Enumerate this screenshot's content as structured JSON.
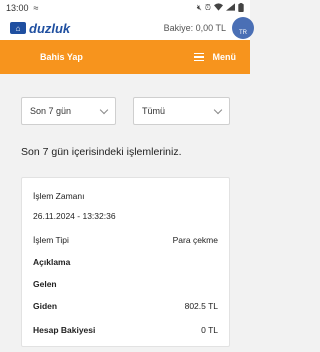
{
  "status_bar": {
    "time": "13:00",
    "left_icon": "vibrate-icon",
    "right_icons": [
      "mute-icon",
      "alarm-icon",
      "wifi-icon",
      "signal-icon",
      "battery-icon"
    ]
  },
  "header": {
    "logo_text": "duzluk",
    "balance": "Bakiye: 0,00 TL",
    "avatar_text": "TR"
  },
  "nav": {
    "bet_label": "Bahis Yap",
    "menu_label": "Menü"
  },
  "filters": {
    "period": "Son 7 gün",
    "type": "Tümü"
  },
  "info_text": "Son 7 gün içerisindeki işlemleriniz.",
  "transaction": {
    "time_label": "İşlem Zamanı",
    "time_value": "26.11.2024 - 13:32:36",
    "type_label": "İşlem Tipi",
    "type_value": "Para çekme",
    "desc_label": "Açıklama",
    "income_label": "Gelen",
    "outgoing_label": "Giden",
    "outgoing_value": "802.5 TL",
    "balance_label": "Hesap Bakiyesi",
    "balance_value": "0 TL"
  },
  "colors": {
    "accent": "#f7941d",
    "brand": "#1f4fa0"
  }
}
